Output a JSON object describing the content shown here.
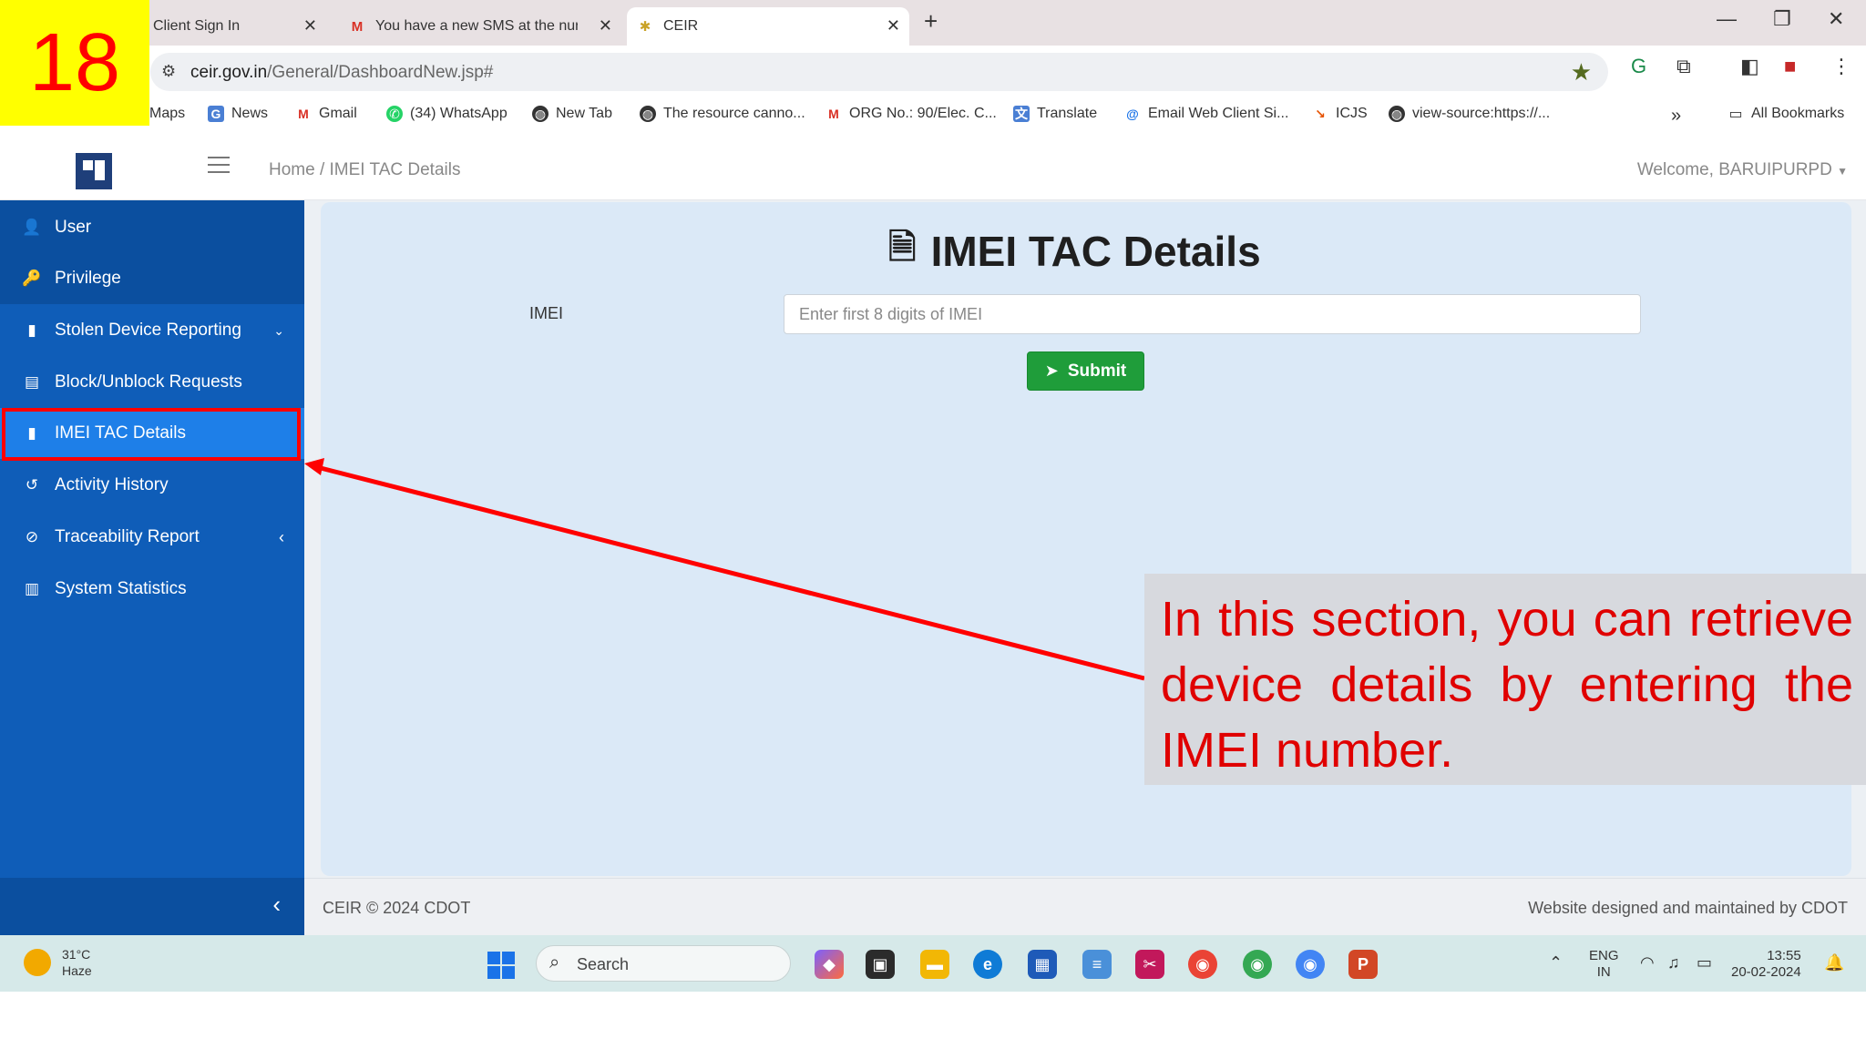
{
  "slide_number": "18",
  "browser": {
    "tabs": [
      {
        "title": "Client Sign In",
        "close": "✕"
      },
      {
        "title": "You have a new SMS at the nur",
        "close": "✕"
      },
      {
        "title": "CEIR",
        "close": "✕"
      }
    ],
    "new_tab": "+",
    "url_host": "ceir.gov.in",
    "url_path": "/General/DashboardNew.jsp#",
    "bookmarks": [
      "Maps",
      "News",
      "Gmail",
      "(34) WhatsApp",
      "New Tab",
      "The resource canno...",
      "ORG No.: 90/Elec. C...",
      "Translate",
      "Email Web Client Si...",
      "ICJS",
      "view-source:https://..."
    ],
    "all_bookmarks": "All Bookmarks"
  },
  "app": {
    "breadcrumb": "Home / IMEI TAC Details",
    "welcome": "Welcome, BARUIPURPD",
    "sidebar": [
      {
        "label": "User",
        "icon": "user-icon"
      },
      {
        "label": "Privilege",
        "icon": "key-icon"
      },
      {
        "label": "Stolen Device Reporting",
        "icon": "mobile-icon",
        "chevron": "⌄"
      },
      {
        "label": "Block/Unblock Requests",
        "icon": "tablet-icon"
      },
      {
        "label": "IMEI TAC Details",
        "icon": "document-icon",
        "active": true
      },
      {
        "label": "Activity History",
        "icon": "history-icon"
      },
      {
        "label": "Traceability Report",
        "icon": "ban-icon",
        "chevron": "‹"
      },
      {
        "label": "System Statistics",
        "icon": "bar-chart-icon"
      }
    ],
    "page_title": "IMEI TAC Details",
    "form": {
      "imei_label": "IMEI",
      "imei_placeholder": "Enter first 8 digits of IMEI",
      "submit_label": "Submit"
    },
    "footer_left": "CEIR © 2024 CDOT",
    "footer_right": "Website designed and maintained by CDOT"
  },
  "callout": {
    "text": "In this section, you can retrieve device details by entering the IMEI number."
  },
  "taskbar": {
    "temperature": "31°C",
    "weather": "Haze",
    "search": "Search",
    "lang_line1": "ENG",
    "lang_line2": "IN",
    "time": "13:55",
    "date": "20-02-2024"
  },
  "colors": {
    "sidebar": "#0f5db8",
    "sidebar_active": "#1e7fe8",
    "submit": "#1f9d3a",
    "annotation": "#ff0000",
    "slide_number_bg": "#ffff00"
  }
}
